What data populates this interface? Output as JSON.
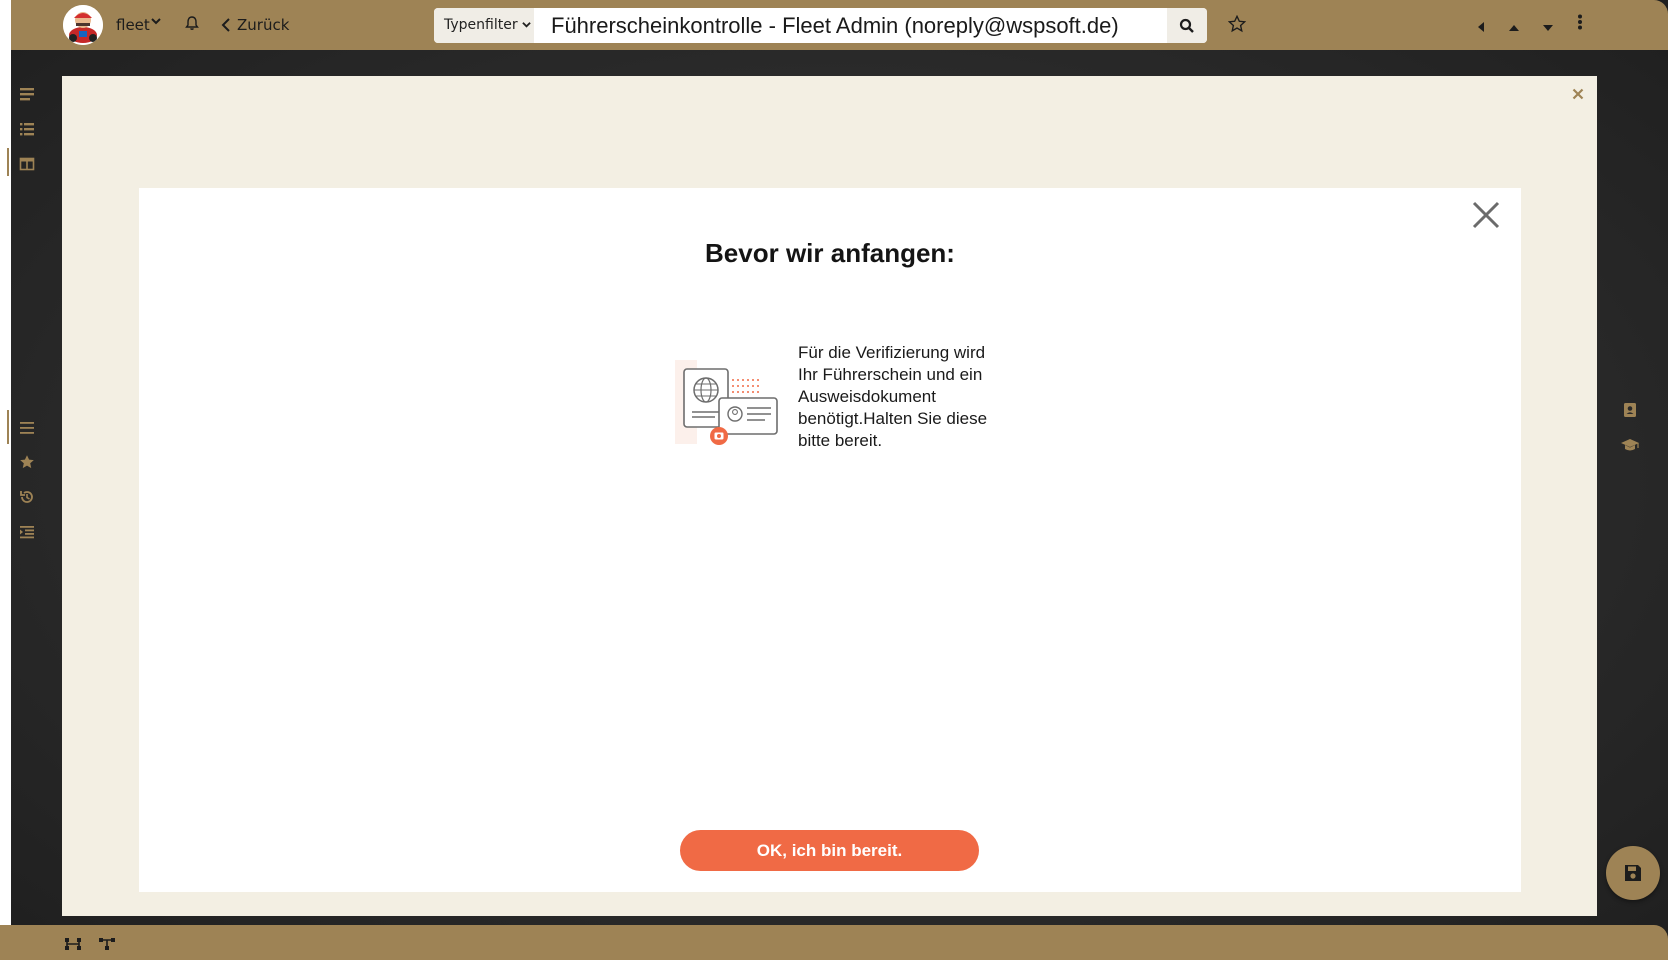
{
  "topbar": {
    "brand_label": "fleet",
    "back_label": "Zurück",
    "type_filter_label": "Typenfilter",
    "search_value": "Führerscheinkontrolle - Fleet Admin (noreply@wspsoft.de)"
  },
  "dialog": {
    "title": "Bevor wir anfangen:",
    "info_text": "Für die Verifizierung wird Ihr Führerschein und ein Ausweisdokument benötigt.Halten Sie diese bitte bereit.",
    "ok_label": "OK, ich bin bereit."
  },
  "icons": {
    "rail_top": [
      "hamburger-icon",
      "list-icon",
      "columns-icon"
    ],
    "rail_bottom": [
      "lines-icon",
      "star-icon",
      "history-icon",
      "indent-list-icon"
    ],
    "right": [
      "address-book-icon",
      "graduation-cap-icon"
    ],
    "bottom": [
      "hierarchy-icon",
      "tree-icon"
    ]
  },
  "colors": {
    "accent": "#9e8355",
    "button": "#f06a45",
    "panel": "#f3efe3"
  }
}
